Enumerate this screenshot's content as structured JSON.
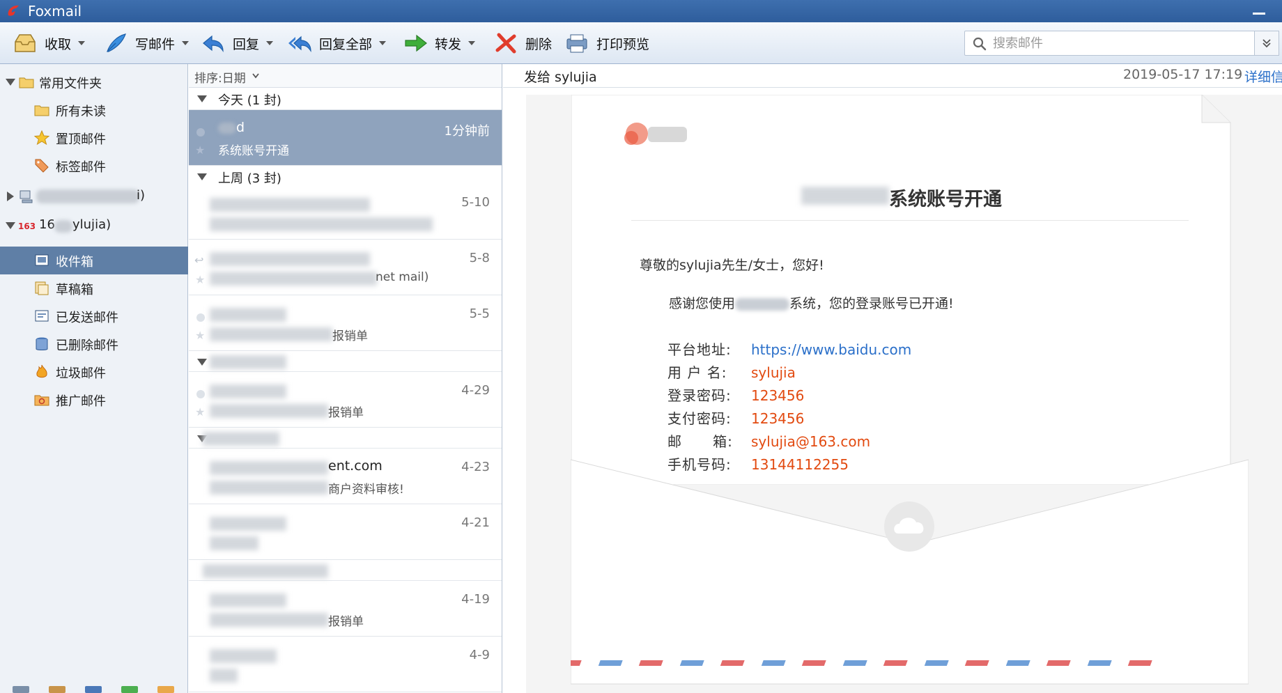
{
  "window": {
    "title": "Foxmail"
  },
  "toolbar": {
    "receive": "收取",
    "compose": "写邮件",
    "reply": "回复",
    "reply_all": "回复全部",
    "forward": "转发",
    "delete": "删除",
    "print_preview": "打印预览"
  },
  "search": {
    "placeholder": "搜索邮件"
  },
  "sidebar": {
    "common_folders": "常用文件夹",
    "all_unread": "所有未读",
    "starred": "置顶邮件",
    "tagged": "标签邮件",
    "account1_suffix": "i)",
    "account2_prefix": "16",
    "account2_suffix": "ylujia)",
    "inbox": "收件箱",
    "drafts": "草稿箱",
    "sent": "已发送邮件",
    "deleted": "已删除邮件",
    "junk": "垃圾邮件",
    "promo": "推广邮件"
  },
  "maillist": {
    "sort_label": "排序:日期",
    "groups": {
      "today": "今天 (1 封)",
      "last_week": "上周 (3 封)"
    },
    "items": [
      {
        "sender": "d",
        "subject": "系统账号开通",
        "date": "1分钟前"
      },
      {
        "sender": "",
        "subject": "",
        "date": "5-10"
      },
      {
        "sender": "",
        "subject": "net mail)",
        "date": "5-8"
      },
      {
        "sender": "",
        "subject": "报销单",
        "date": "5-5"
      },
      {
        "sender": "",
        "subject": "报销单",
        "date": "4-29"
      },
      {
        "sender": "ent.com",
        "subject": "商户资料审核!",
        "date": "4-23"
      },
      {
        "sender": "",
        "subject": "",
        "date": "4-21"
      },
      {
        "sender": "",
        "subject": "报销单",
        "date": "4-19"
      },
      {
        "sender": "",
        "subject": "",
        "date": "4-9"
      }
    ]
  },
  "reading": {
    "to": "发给 sylujia",
    "datetime": "2019-05-17 17:19",
    "detail_link": "详细信",
    "title": "系统账号开通",
    "greeting": "尊敬的sylujia先生/女士，您好!",
    "thanks_prefix": "感谢您使用",
    "thanks_suffix": "系统，您的登录账号已开通!",
    "fields": [
      {
        "key": "平台地址:",
        "value": "https://www.baidu.com"
      },
      {
        "key": "用 户 名:",
        "value": "sylujia"
      },
      {
        "key": "登录密码:",
        "value": "123456"
      },
      {
        "key": "支付密码:",
        "value": "123456"
      },
      {
        "key": "邮      箱:",
        "value": "sylujia@163.com"
      },
      {
        "key": "手机号码:",
        "value": "13144112255"
      }
    ]
  }
}
